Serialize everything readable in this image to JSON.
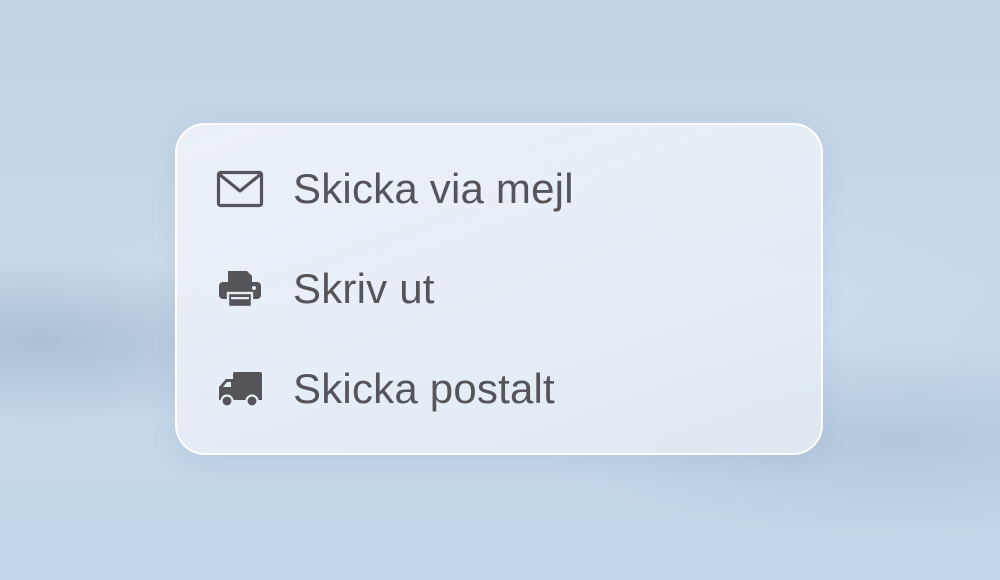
{
  "menu": {
    "items": [
      {
        "id": "email",
        "label": "Skicka via mejl",
        "icon": "envelope-icon"
      },
      {
        "id": "print",
        "label": "Skriv ut",
        "icon": "printer-icon"
      },
      {
        "id": "mail",
        "label": "Skicka postalt",
        "icon": "truck-icon"
      }
    ]
  },
  "colors": {
    "text": "#555559",
    "icon": "#555559",
    "card_border": "#ffffff",
    "background": "#c5d7e9"
  }
}
